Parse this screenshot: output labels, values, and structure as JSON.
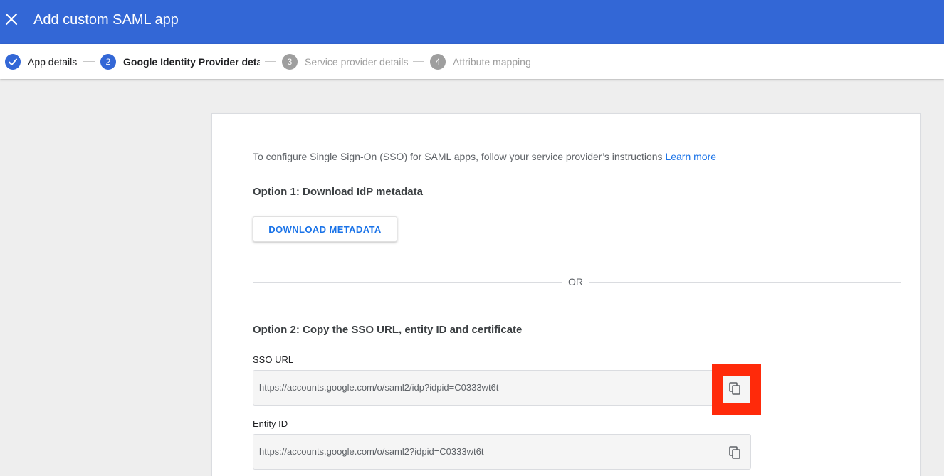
{
  "header": {
    "title": "Add custom SAML app",
    "close_icon": "close-icon",
    "background": "#3367d6"
  },
  "stepper": {
    "steps": [
      {
        "number": "✓",
        "label": "App details",
        "state": "done"
      },
      {
        "number": "2",
        "label": "Google Identity Provider details",
        "state": "active"
      },
      {
        "number": "3",
        "label": "Service provider details",
        "state": "pending"
      },
      {
        "number": "4",
        "label": "Attribute mapping",
        "state": "pending"
      }
    ]
  },
  "main": {
    "intro_text": "To configure Single Sign-On (SSO) for SAML apps, follow your service provider’s instructions",
    "learn_more_label": "Learn more",
    "option1_title": "Option 1: Download IdP metadata",
    "download_button_label": "DOWNLOAD METADATA",
    "or_label": "OR",
    "option2_title": "Option 2: Copy the SSO URL, entity ID and certificate",
    "sso_url": {
      "label": "SSO URL",
      "value": "https://accounts.google.com/o/saml2/idp?idpid=C0333wt6t",
      "copy_icon": "copy-icon"
    },
    "entity_id": {
      "label": "Entity ID",
      "value": "https://accounts.google.com/o/saml2?idpid=C0333wt6t",
      "copy_icon": "copy-icon"
    }
  },
  "colors": {
    "accent": "#3367d6",
    "link": "#1a73e8",
    "highlight": "#ff2a0a"
  }
}
